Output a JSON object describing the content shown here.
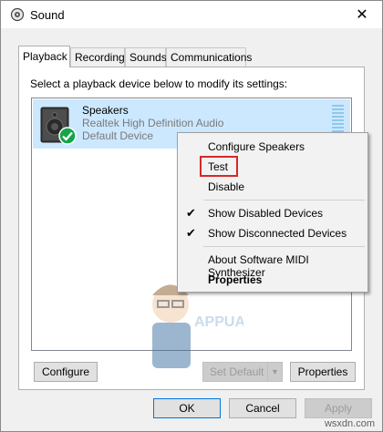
{
  "window": {
    "title": "Sound",
    "icon": "speaker-icon",
    "close": "✕"
  },
  "tabs": [
    {
      "label": "Playback",
      "active": true
    },
    {
      "label": "Recording",
      "active": false
    },
    {
      "label": "Sounds",
      "active": false
    },
    {
      "label": "Communications",
      "active": false
    }
  ],
  "playback": {
    "instruction": "Select a playback device below to modify its settings:",
    "device": {
      "name": "Speakers",
      "driver": "Realtek High Definition Audio",
      "status": "Default Device",
      "status_icon": "default-check-icon"
    }
  },
  "context_menu": {
    "items": [
      {
        "label": "Configure Speakers",
        "checked": false,
        "bold": false
      },
      {
        "label": "Test",
        "checked": false,
        "bold": false,
        "highlighted": true
      },
      {
        "label": "Disable",
        "checked": false,
        "bold": false
      },
      {
        "label": "Show Disabled Devices",
        "checked": true,
        "bold": false
      },
      {
        "label": "Show Disconnected Devices",
        "checked": true,
        "bold": false
      },
      {
        "label": "About Software MIDI Synthesizer",
        "checked": false,
        "bold": false
      },
      {
        "label": "Properties",
        "checked": false,
        "bold": true
      }
    ],
    "check_glyph": "✔",
    "highlight_color": "#d62828"
  },
  "panel_buttons": {
    "configure": "Configure",
    "set_default": "Set Default",
    "properties": "Properties"
  },
  "dialog_buttons": {
    "ok": "OK",
    "cancel": "Cancel",
    "apply": "Apply"
  },
  "watermark_site": "wsxdn.com",
  "colors": {
    "selection": "#cce8ff",
    "default_check": "#16a34a",
    "focus_border": "#0078d7"
  }
}
